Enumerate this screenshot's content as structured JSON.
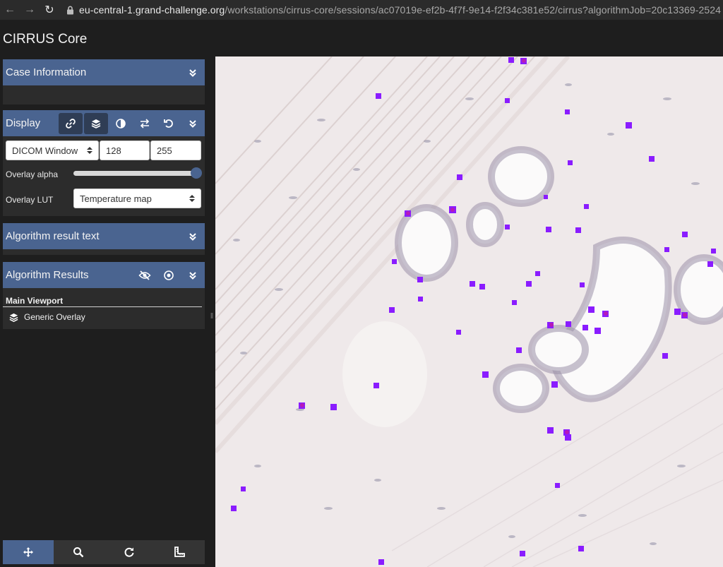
{
  "browser": {
    "url_domain": "eu-central-1.grand-challenge.org",
    "url_path": "/workstations/cirrus-core/sessions/ac07019e-ef2b-4f7f-9e14-f2f34c381e52/cirrus?algorithmJob=20c13369-2524"
  },
  "app": {
    "title": "CIRRUS Core"
  },
  "panels": {
    "case_information": {
      "title": "Case Information"
    },
    "display": {
      "title": "Display",
      "window_mode": "DICOM Window",
      "window_min": "128",
      "window_max": "255",
      "overlay_alpha_label": "Overlay alpha",
      "overlay_alpha_value": 1.0,
      "overlay_lut_label": "Overlay LUT",
      "overlay_lut_value": "Temperature map"
    },
    "algorithm_result_text": {
      "title": "Algorithm result text"
    },
    "algorithm_results": {
      "title": "Algorithm Results",
      "viewport_title": "Main Viewport",
      "overlay_item": "Generic Overlay"
    }
  },
  "toolbar": {
    "tools": [
      "move-icon",
      "zoom-icon",
      "rotate-icon",
      "ruler-icon"
    ],
    "active_tool": "move-icon"
  },
  "colors": {
    "accent": "#4a6490",
    "overlay_marker": "#8a1cff",
    "overlay_marker_hot": "#d01a8a",
    "tissue_background": "#efe9e9"
  }
}
